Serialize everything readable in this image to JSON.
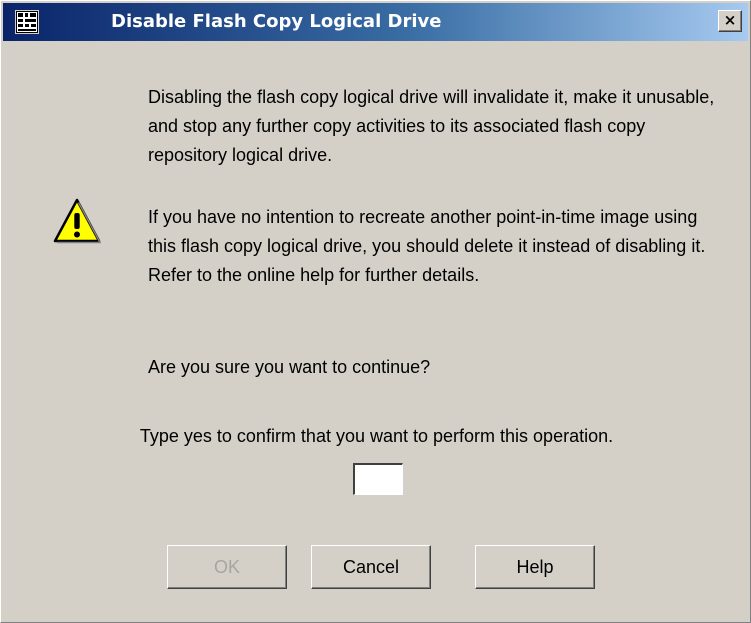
{
  "window": {
    "title": "Disable Flash Copy Logical Drive",
    "close_label": "×",
    "icon": "grid-app-icon"
  },
  "dialog": {
    "warning_icon": "warning-icon",
    "paragraph1": "Disabling the flash copy logical drive will invalidate it, make it unusable, and stop any further copy activities to its associated flash copy repository logical drive.",
    "paragraph2": "If you have no intention to recreate another point-in-time image using this flash copy logical drive, you should delete it instead of disabling it. Refer to the online help for further details.",
    "question": "Are you sure you want to continue?",
    "confirm_label": "Type yes to confirm that you want to perform this operation.",
    "confirm_value": ""
  },
  "buttons": {
    "ok": "OK",
    "cancel": "Cancel",
    "help": "Help"
  }
}
